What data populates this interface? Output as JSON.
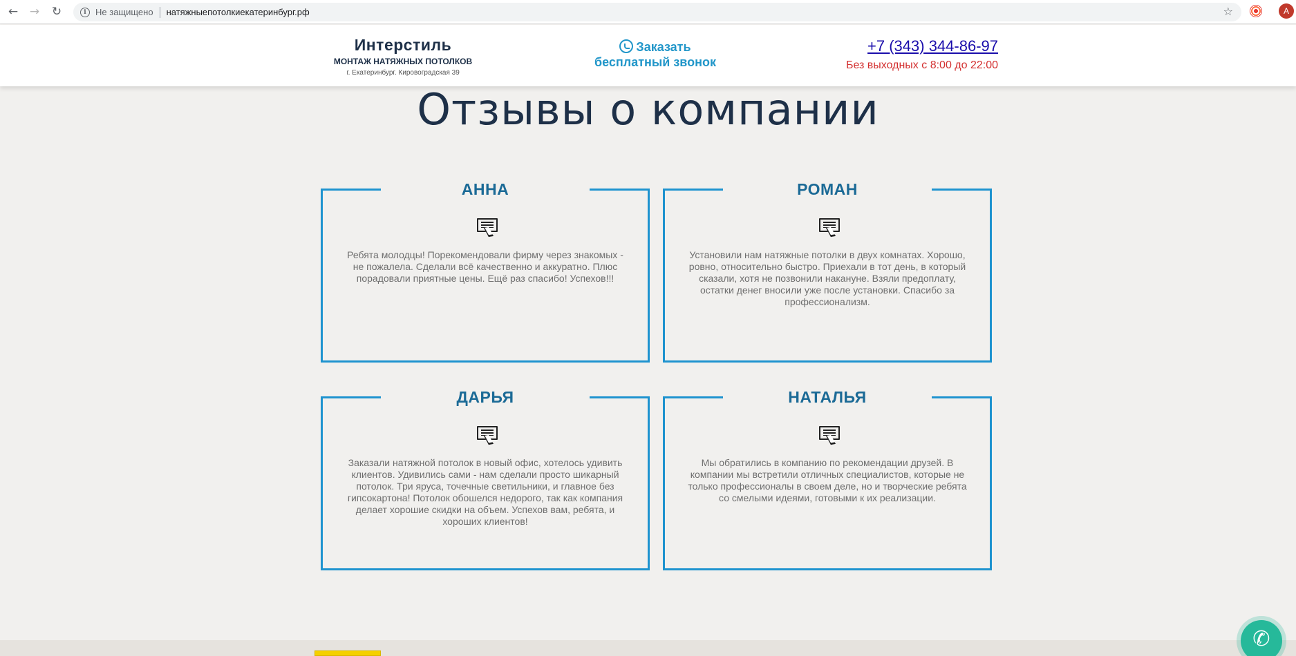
{
  "browser": {
    "security_label": "Не защищено",
    "url": "натяжныепотолкиекатеринбург.рф",
    "profile_initial": "A"
  },
  "header": {
    "brand_name": "Интерстиль",
    "brand_tagline": "МОНТАЖ НАТЯЖНЫХ ПОТОЛКОВ",
    "brand_address": "г. Екатеринбург. Кировоградская 39",
    "callback_line1": "Заказать",
    "callback_line2": "бесплатный звонок",
    "phone": "+7 (343) 344-86-97",
    "work_hours": "Без выходных с 8:00 до 22:00"
  },
  "reviews": {
    "title": "Отзывы о компании",
    "items": [
      {
        "name": "АННА",
        "text": "Ребята молодцы! Порекомендовали фирму через знакомых - не пожалела. Сделали всё качественно и аккуратно. Плюс порадовали приятные цены. Ещё раз спасибо! Успехов!!!"
      },
      {
        "name": "РОМАН",
        "text": "Установили нам натяжные потолки в двух комнатах. Хорошо, ровно, относительно быстро. Приехали в тот день, в который сказали, хотя не позвонили накануне. Взяли предоплату, остатки денег вносили уже после установки. Спасибо за профессионализм."
      },
      {
        "name": "ДАРЬЯ",
        "text": "Заказали натяжной потолок в новый офис, хотелось удивить клиентов. Удивились сами - нам сделали просто шикарный потолок. Три яруса, точечные светильники, и главное без гипсокартона! Потолок обошелся недорого, так как компания делает хорошие скидки на объем. Успехов вам, ребята, и хороших клиентов!"
      },
      {
        "name": "НАТАЛЬЯ",
        "text": "Мы обратились в компанию по рекомендации друзей. В компании мы встретили отличных специалистов, которые не только профессионалы в своем деле, но и творческие ребята со смелыми идеями, готовыми к их реализации."
      }
    ]
  },
  "icons": {
    "back": "back-arrow-icon",
    "forward": "forward-arrow-icon",
    "reload": "reload-icon",
    "info": "info-icon",
    "star": "star-icon",
    "whatsapp": "whatsapp-icon",
    "comment": "comment-icon",
    "phone": "phone-icon"
  },
  "colors": {
    "accent_blue": "#1e93cf",
    "name_blue": "#1b6a96",
    "title_navy": "#1e3048",
    "hours_red": "#d32f2f",
    "fab_green": "#26b99a"
  }
}
